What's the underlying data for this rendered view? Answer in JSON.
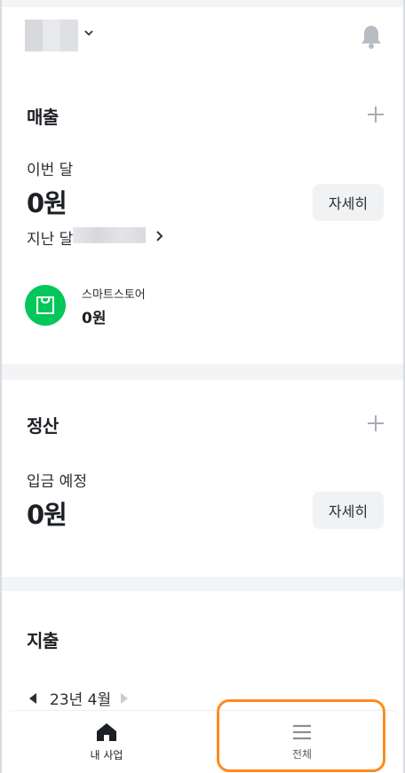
{
  "header": {
    "business_switch_icon": "chevron-down-icon",
    "notification_icon": "bell-icon"
  },
  "sales": {
    "title": "매출",
    "this_month_label": "이번 달",
    "this_month_amount": "0원",
    "detail_label": "자세히",
    "last_month_label": "지난 달",
    "store": {
      "name": "스마트스토어",
      "amount": "0원"
    }
  },
  "settlement": {
    "title": "정산",
    "expected_label": "입금 예정",
    "expected_amount": "0원",
    "detail_label": "자세히"
  },
  "expense": {
    "title": "지출",
    "month": "23년 4월"
  },
  "bottom_nav": {
    "items": [
      {
        "label": "내 사업",
        "icon": "home-icon"
      },
      {
        "label": "전체",
        "icon": "menu-icon"
      }
    ]
  },
  "colors": {
    "brand_green": "#03c75a",
    "highlight": "#ff8a1f"
  }
}
